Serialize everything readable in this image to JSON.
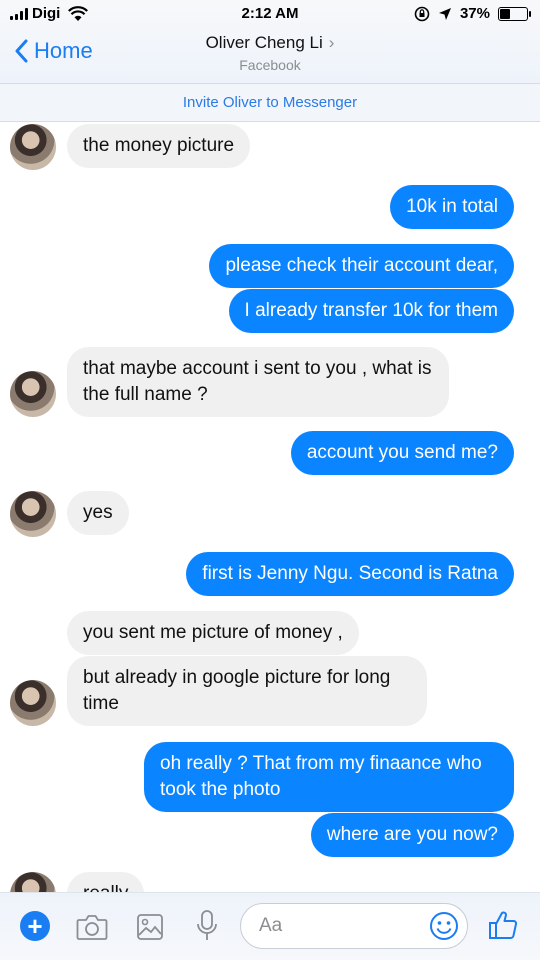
{
  "status": {
    "carrier": "Digi",
    "time": "2:12 AM",
    "battery_text": "37%",
    "battery_level": 0.37
  },
  "header": {
    "back_label": "Home",
    "contact_name": "Oliver Cheng Li",
    "contact_sub": "Facebook",
    "invite_text": "Invite Oliver to Messenger"
  },
  "messages": {
    "m1": "the money picture",
    "m2": "10k in total",
    "m3": "please check their  account dear,",
    "m4": "I already transfer 10k for them",
    "m5": "that maybe account i sent to you , what is the full name ?",
    "m6": "account you send me?",
    "m7": "yes",
    "m8": "first is Jenny Ngu. Second is Ratna",
    "m9": "you sent me picture of money ,",
    "m10": "but already in google picture for long time",
    "m11": "oh really ? That from my finaance who took the photo",
    "m12": "where are you now?",
    "m13": "really"
  },
  "composer": {
    "placeholder": "Aa"
  },
  "colors": {
    "accent": "#0b84ff",
    "incoming_bubble": "#f0f0f0"
  },
  "icons": [
    "plus-icon",
    "camera-icon",
    "photo-icon",
    "microphone-icon",
    "emoji-icon",
    "thumbs-up-icon",
    "back-chevron-icon",
    "wifi-icon",
    "location-icon",
    "lock-rotation-icon"
  ]
}
